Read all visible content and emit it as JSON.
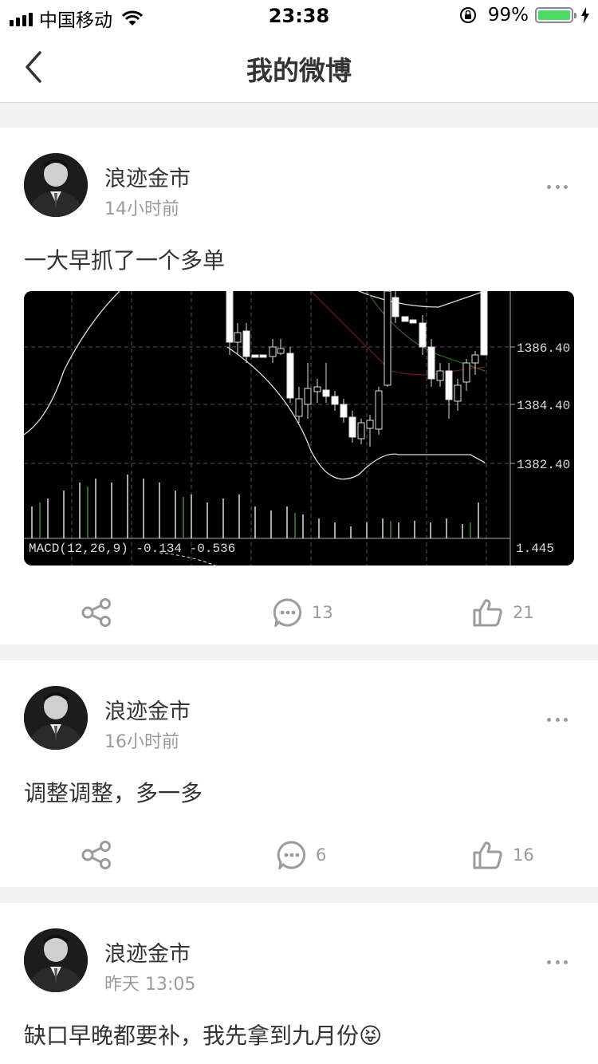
{
  "status_bar": {
    "carrier": "中国移动",
    "time": "23:38",
    "battery_percent": "99%",
    "battery_level": 0.99
  },
  "nav": {
    "title": "我的微博",
    "back_icon": "chevron-left-icon"
  },
  "posts": [
    {
      "author": "浪迹金市",
      "time": "14小时前",
      "text": "一大早抓了一个多单",
      "image": {
        "price_labels": [
          "1386.40",
          "1384.40",
          "1382.40"
        ],
        "macd_label": "MACD(12,26,9) -0.134 -0.536",
        "macd_value": "1.445"
      },
      "actions": {
        "comments": "13",
        "likes": "21"
      }
    },
    {
      "author": "浪迹金市",
      "time": "16小时前",
      "text": "调整调整，多一多",
      "actions": {
        "comments": "6",
        "likes": "16"
      }
    },
    {
      "author": "浪迹金市",
      "time": "昨天 13:05",
      "text": "缺口早晚都要补，我先拿到九月份",
      "emoji": "😝"
    }
  ],
  "colors": {
    "background": "#f2f2f2",
    "card": "#ffffff",
    "text": "#333333",
    "muted": "#9b9b9b",
    "battery": "#4cd964"
  }
}
